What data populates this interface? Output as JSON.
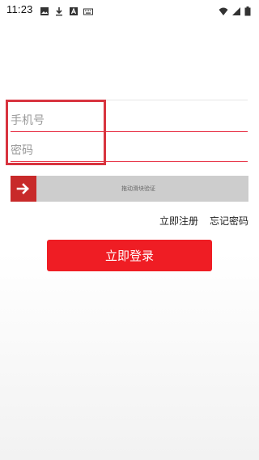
{
  "status_bar": {
    "time": "11:23",
    "left_icons": [
      "image-icon",
      "download-icon",
      "font-icon",
      "keyboard-icon"
    ],
    "right_icons": [
      "wifi-icon",
      "signal-icon",
      "battery-icon"
    ]
  },
  "form": {
    "phone_placeholder": "手机号",
    "password_placeholder": "密码",
    "slider_text": "拖动滑块验证",
    "accent_color": "#e8374a"
  },
  "links": {
    "register": "立即注册",
    "forgot_password": "忘记密码"
  },
  "login_button": {
    "label": "立即登录",
    "color": "#ef1d24"
  }
}
